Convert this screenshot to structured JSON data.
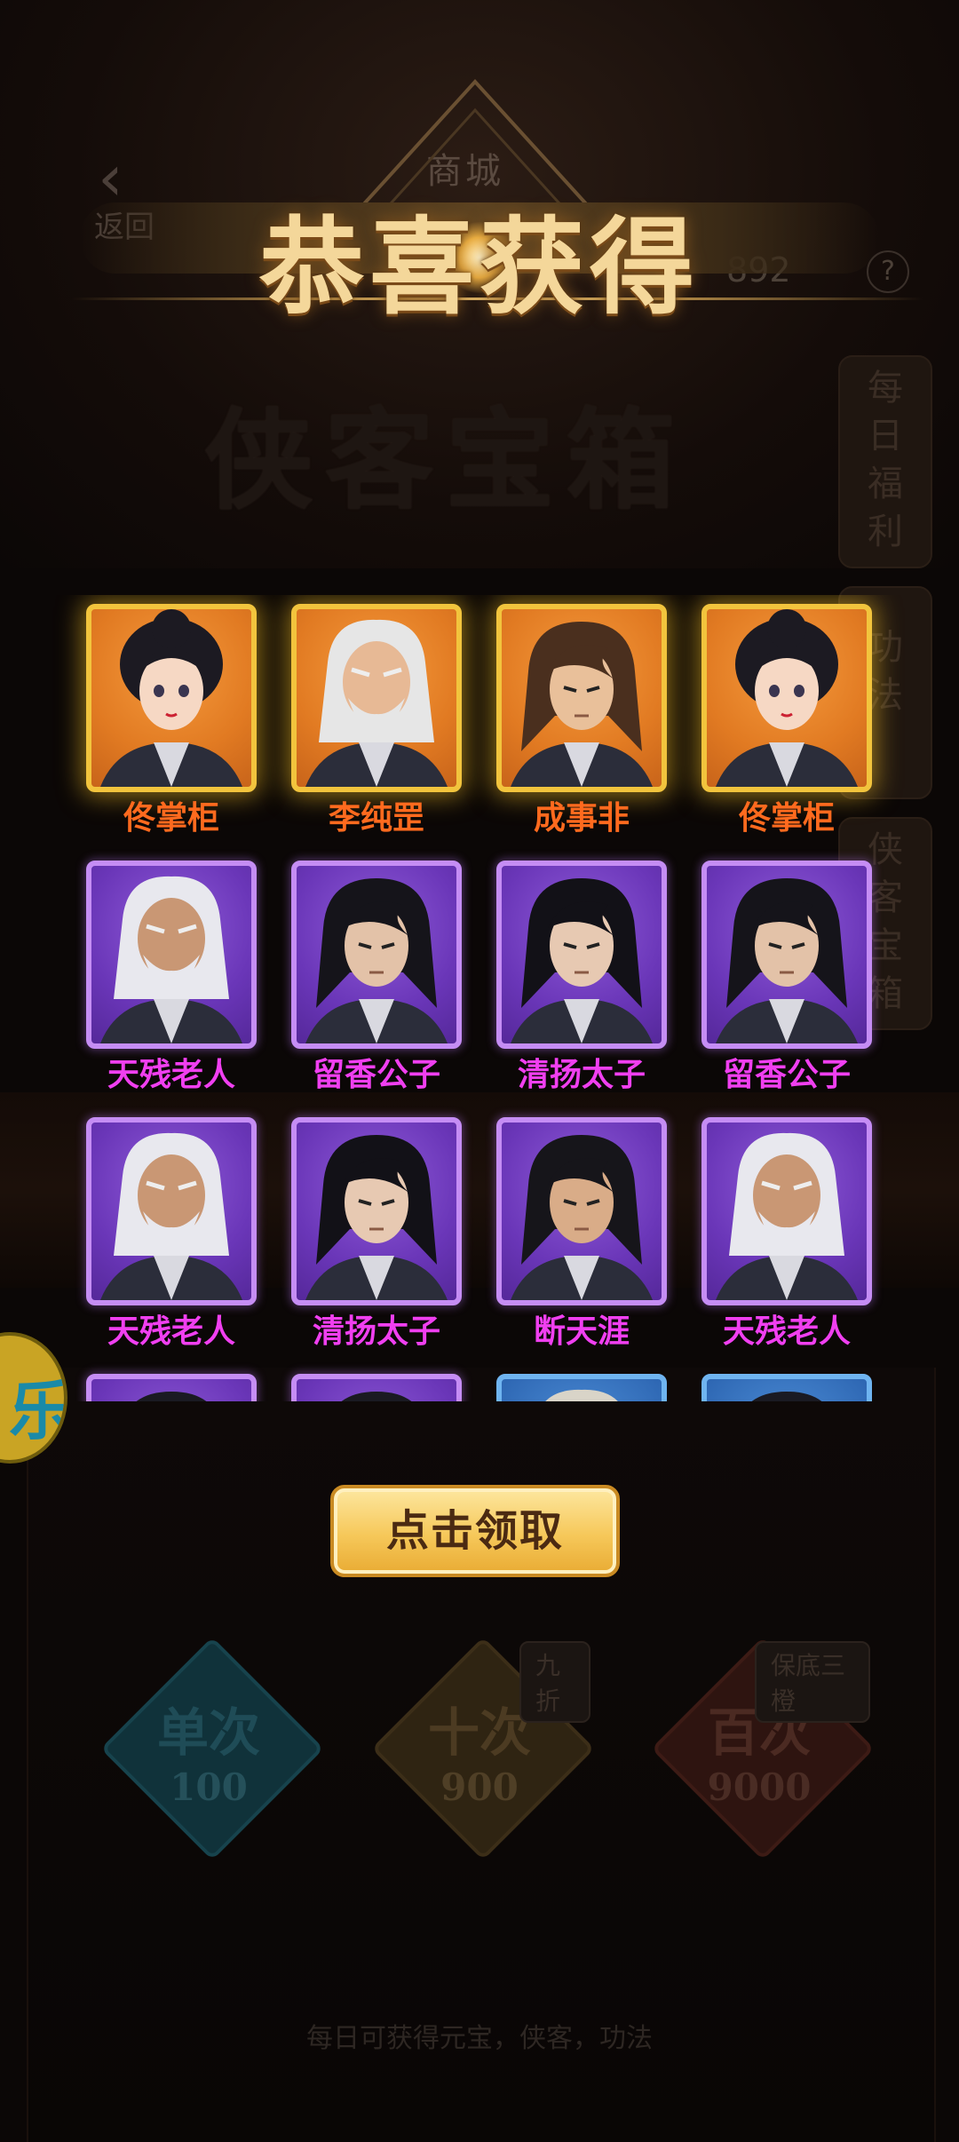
{
  "background": {
    "back_label": "返回",
    "back_arrow": "‹",
    "shop_title": "商城",
    "coins": "892",
    "help": "?",
    "heading": "侠客宝箱",
    "side_tabs": [
      {
        "label": "每日福利",
        "icon": "daily-tab"
      },
      {
        "label": "功法",
        "icon": "skill-tab"
      },
      {
        "label": "侠客宝箱",
        "icon": "hero-chest-tab"
      }
    ],
    "left_badge": "乐",
    "gacha": [
      {
        "name": "单次",
        "price": "100",
        "tag": "",
        "color": "#1a4f5c"
      },
      {
        "name": "十次",
        "price": "900",
        "tag": "九折",
        "color": "#4d3a1c"
      },
      {
        "name": "百次",
        "price": "9000",
        "tag": "保底三橙",
        "color": "#4d1e16"
      }
    ],
    "footer_note": "每日可获得元宝，侠客，功法"
  },
  "popup": {
    "title": "恭喜获得",
    "claim_label": "点击领取",
    "rewards": [
      {
        "name": "佟掌柜",
        "rarity": "gold",
        "hair": "#1c1a22",
        "skin": "#f6d8c4",
        "style": "female"
      },
      {
        "name": "李纯罡",
        "rarity": "gold",
        "hair": "#e6e6e6",
        "skin": "#e7b995",
        "style": "elder"
      },
      {
        "name": "成事非",
        "rarity": "gold",
        "hair": "#4a2f1e",
        "skin": "#e9c09a",
        "style": "male"
      },
      {
        "name": "佟掌柜",
        "rarity": "gold",
        "hair": "#1c1a22",
        "skin": "#f6d8c4",
        "style": "female"
      },
      {
        "name": "天残老人",
        "rarity": "purple",
        "hair": "#e8e8ee",
        "skin": "#c99774",
        "style": "elder"
      },
      {
        "name": "留香公子",
        "rarity": "purple",
        "hair": "#15141a",
        "skin": "#e3c2a8",
        "style": "male"
      },
      {
        "name": "清扬太子",
        "rarity": "purple",
        "hair": "#121117",
        "skin": "#e7c9b2",
        "style": "male"
      },
      {
        "name": "留香公子",
        "rarity": "purple",
        "hair": "#15141a",
        "skin": "#e3c2a8",
        "style": "male"
      },
      {
        "name": "天残老人",
        "rarity": "purple",
        "hair": "#e8e8ee",
        "skin": "#c99774",
        "style": "elder"
      },
      {
        "name": "清扬太子",
        "rarity": "purple",
        "hair": "#121117",
        "skin": "#e7c9b2",
        "style": "male"
      },
      {
        "name": "断天涯",
        "rarity": "purple",
        "hair": "#16151a",
        "skin": "#d9ac88",
        "style": "male"
      },
      {
        "name": "天残老人",
        "rarity": "purple",
        "hair": "#e8e8ee",
        "skin": "#c99774",
        "style": "elder"
      },
      {
        "name": "",
        "rarity": "purple",
        "hair": "#1a1a22",
        "skin": "#d9ac88",
        "style": "male"
      },
      {
        "name": "",
        "rarity": "purple",
        "hair": "#1a1a22",
        "skin": "#d9ac88",
        "style": "male"
      },
      {
        "name": "",
        "rarity": "blue",
        "hair": "#d9d4c8",
        "skin": "#d9ac88",
        "style": "elder"
      },
      {
        "name": "",
        "rarity": "blue",
        "hair": "#1a1a22",
        "skin": "#d9ac88",
        "style": "male"
      }
    ]
  }
}
